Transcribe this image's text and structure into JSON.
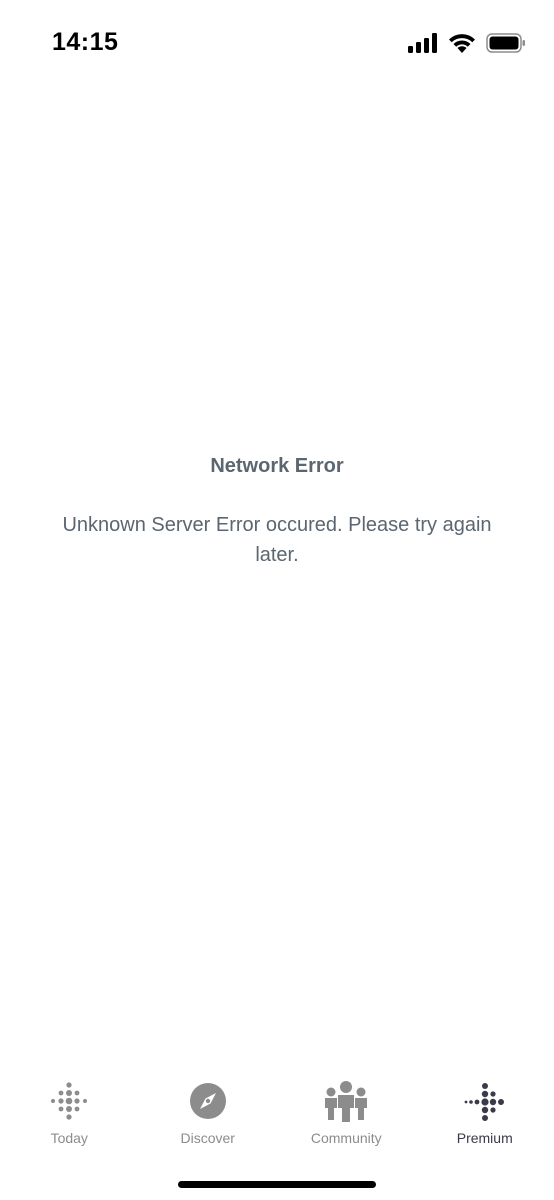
{
  "status_bar": {
    "time": "14:15",
    "icons": [
      "signal-icon",
      "wifi-icon",
      "battery-icon"
    ]
  },
  "error": {
    "title": "Network Error",
    "message": "Unknown Server Error occured. Please try again later."
  },
  "tab_bar": {
    "active": "premium",
    "items": [
      {
        "id": "today",
        "label": "Today",
        "icon": "fitbit-dots-icon"
      },
      {
        "id": "discover",
        "label": "Discover",
        "icon": "compass-icon"
      },
      {
        "id": "community",
        "label": "Community",
        "icon": "community-people-icon"
      },
      {
        "id": "premium",
        "label": "Premium",
        "icon": "premium-dots-icon"
      }
    ]
  },
  "colors": {
    "text": "#5b6670",
    "tab_inactive": "#8c8c8c",
    "tab_active": "#3a3a4a",
    "background": "#ffffff"
  }
}
